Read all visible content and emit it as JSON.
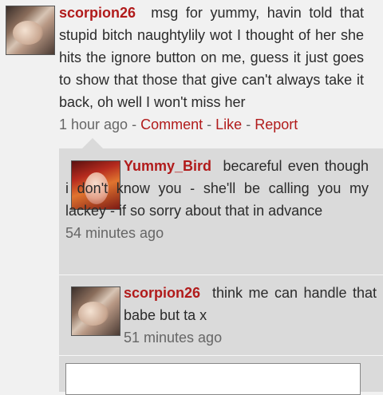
{
  "post": {
    "username": "scorpion26",
    "message": "msg for yummy, havin told that stupid bitch naughtylily wot I thought of her she hits the ignore button on me, guess it just goes to show that those that give can't always take it back, oh well I won't miss her",
    "time": "1 hour ago",
    "actions": {
      "comment": "Comment",
      "like": "Like",
      "report": "Report",
      "separator": "-"
    }
  },
  "replies": [
    {
      "username": "Yummy_Bird",
      "message": "becareful even though i don't know you - she'll be calling you my lackey - if so sorry about that in advance",
      "time": "54 minutes ago"
    },
    {
      "username": "scorpion26",
      "message": "think me can handle that babe but ta x",
      "time": "51 minutes ago"
    }
  ],
  "colors": {
    "link": "#b11b1b",
    "reply_bg": "#dadada",
    "page_bg": "#f1f1f1"
  }
}
